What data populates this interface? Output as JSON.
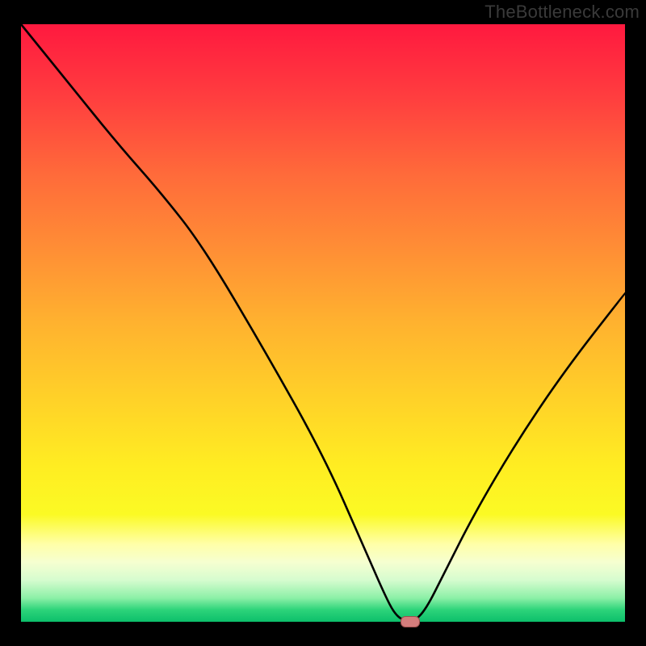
{
  "attribution": "TheBottleneck.com",
  "chart_data": {
    "type": "line",
    "title": "",
    "xlabel": "",
    "ylabel": "",
    "xlim": [
      0,
      100
    ],
    "ylim": [
      0,
      100
    ],
    "grid": false,
    "legend_position": "none",
    "series": [
      {
        "name": "bottleneck-curve",
        "x": [
          0,
          8,
          16,
          23,
          30,
          40,
          50,
          57,
          60,
          62,
          64,
          65,
          67,
          70,
          75,
          82,
          90,
          100
        ],
        "values": [
          100,
          90,
          80,
          72,
          63,
          46,
          28,
          12,
          5,
          1,
          0,
          0,
          2,
          8,
          18,
          30,
          42,
          55
        ]
      }
    ],
    "marker": {
      "x": 64.5,
      "y_value": 0,
      "color": "#d47d7c"
    },
    "colors": {
      "curve": "#000000",
      "background_top": "#ff193f",
      "background_bottom": "#0cbf6b",
      "frame": "#000000"
    }
  }
}
